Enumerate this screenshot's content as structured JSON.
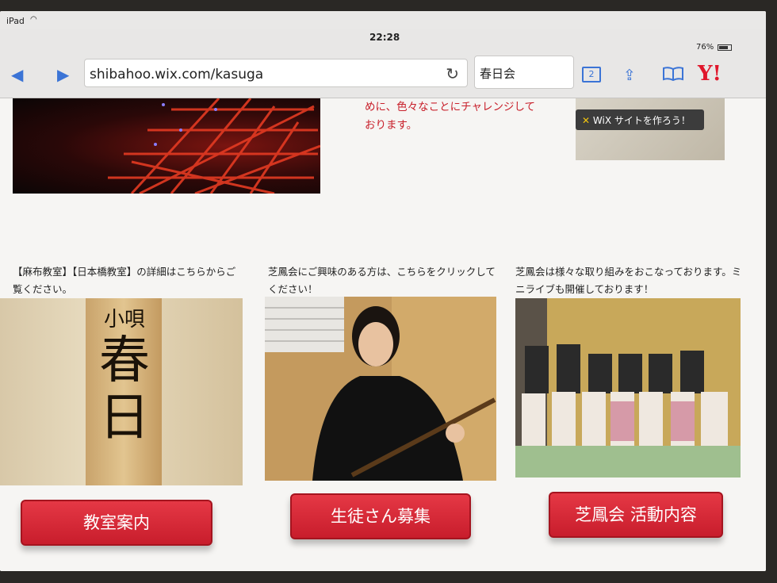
{
  "statusbar": {
    "device": "iPad",
    "wifi": "wifi-icon",
    "time": "22:28",
    "battery": "76%"
  },
  "browser": {
    "back": "◀",
    "forward": "▶",
    "url": "shibahoo.wix.com/kasuga",
    "reload": "↻",
    "search_text": "春日会",
    "tabs_count": "2",
    "share": "⇪",
    "bookmarks": "📖",
    "yahoo": "Y!"
  },
  "content": {
    "intro_lines": [
      "めに、色々なことにチャレンジして",
      "おります。"
    ],
    "wix_badge": "WiX サイトを作ろう！",
    "wix_x": "✕",
    "columns": [
      {
        "caption": "【麻布教室】【日本橋教室】の詳細はこちらからご覧ください。",
        "sign_small": "小唄",
        "sign_big1": "春",
        "sign_big2": "日",
        "button": "教室案内"
      },
      {
        "caption": "芝鳳会にご興味のある方は、こちらをクリックしてください！",
        "button": "生徒さん募集"
      },
      {
        "caption": "芝鳳会は様々な取り組みをおこなっております。ミニライブも開催しております！",
        "button": "芝鳳会 活動内容"
      }
    ]
  },
  "colors": {
    "accent_red": "#d42432",
    "link_blue": "#3b74d6",
    "intro_red": "#c8202b"
  }
}
